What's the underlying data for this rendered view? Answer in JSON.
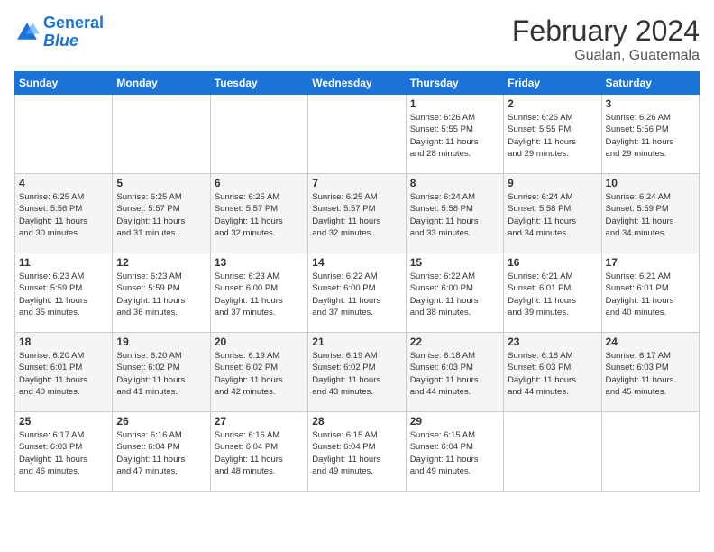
{
  "header": {
    "logo_line1": "General",
    "logo_line2": "Blue",
    "month_title": "February 2024",
    "location": "Gualan, Guatemala"
  },
  "days_of_week": [
    "Sunday",
    "Monday",
    "Tuesday",
    "Wednesday",
    "Thursday",
    "Friday",
    "Saturday"
  ],
  "weeks": [
    [
      {
        "day": "",
        "info": ""
      },
      {
        "day": "",
        "info": ""
      },
      {
        "day": "",
        "info": ""
      },
      {
        "day": "",
        "info": ""
      },
      {
        "day": "1",
        "info": "Sunrise: 6:26 AM\nSunset: 5:55 PM\nDaylight: 11 hours\nand 28 minutes."
      },
      {
        "day": "2",
        "info": "Sunrise: 6:26 AM\nSunset: 5:55 PM\nDaylight: 11 hours\nand 29 minutes."
      },
      {
        "day": "3",
        "info": "Sunrise: 6:26 AM\nSunset: 5:56 PM\nDaylight: 11 hours\nand 29 minutes."
      }
    ],
    [
      {
        "day": "4",
        "info": "Sunrise: 6:25 AM\nSunset: 5:56 PM\nDaylight: 11 hours\nand 30 minutes."
      },
      {
        "day": "5",
        "info": "Sunrise: 6:25 AM\nSunset: 5:57 PM\nDaylight: 11 hours\nand 31 minutes."
      },
      {
        "day": "6",
        "info": "Sunrise: 6:25 AM\nSunset: 5:57 PM\nDaylight: 11 hours\nand 32 minutes."
      },
      {
        "day": "7",
        "info": "Sunrise: 6:25 AM\nSunset: 5:57 PM\nDaylight: 11 hours\nand 32 minutes."
      },
      {
        "day": "8",
        "info": "Sunrise: 6:24 AM\nSunset: 5:58 PM\nDaylight: 11 hours\nand 33 minutes."
      },
      {
        "day": "9",
        "info": "Sunrise: 6:24 AM\nSunset: 5:58 PM\nDaylight: 11 hours\nand 34 minutes."
      },
      {
        "day": "10",
        "info": "Sunrise: 6:24 AM\nSunset: 5:59 PM\nDaylight: 11 hours\nand 34 minutes."
      }
    ],
    [
      {
        "day": "11",
        "info": "Sunrise: 6:23 AM\nSunset: 5:59 PM\nDaylight: 11 hours\nand 35 minutes."
      },
      {
        "day": "12",
        "info": "Sunrise: 6:23 AM\nSunset: 5:59 PM\nDaylight: 11 hours\nand 36 minutes."
      },
      {
        "day": "13",
        "info": "Sunrise: 6:23 AM\nSunset: 6:00 PM\nDaylight: 11 hours\nand 37 minutes."
      },
      {
        "day": "14",
        "info": "Sunrise: 6:22 AM\nSunset: 6:00 PM\nDaylight: 11 hours\nand 37 minutes."
      },
      {
        "day": "15",
        "info": "Sunrise: 6:22 AM\nSunset: 6:00 PM\nDaylight: 11 hours\nand 38 minutes."
      },
      {
        "day": "16",
        "info": "Sunrise: 6:21 AM\nSunset: 6:01 PM\nDaylight: 11 hours\nand 39 minutes."
      },
      {
        "day": "17",
        "info": "Sunrise: 6:21 AM\nSunset: 6:01 PM\nDaylight: 11 hours\nand 40 minutes."
      }
    ],
    [
      {
        "day": "18",
        "info": "Sunrise: 6:20 AM\nSunset: 6:01 PM\nDaylight: 11 hours\nand 40 minutes."
      },
      {
        "day": "19",
        "info": "Sunrise: 6:20 AM\nSunset: 6:02 PM\nDaylight: 11 hours\nand 41 minutes."
      },
      {
        "day": "20",
        "info": "Sunrise: 6:19 AM\nSunset: 6:02 PM\nDaylight: 11 hours\nand 42 minutes."
      },
      {
        "day": "21",
        "info": "Sunrise: 6:19 AM\nSunset: 6:02 PM\nDaylight: 11 hours\nand 43 minutes."
      },
      {
        "day": "22",
        "info": "Sunrise: 6:18 AM\nSunset: 6:03 PM\nDaylight: 11 hours\nand 44 minutes."
      },
      {
        "day": "23",
        "info": "Sunrise: 6:18 AM\nSunset: 6:03 PM\nDaylight: 11 hours\nand 44 minutes."
      },
      {
        "day": "24",
        "info": "Sunrise: 6:17 AM\nSunset: 6:03 PM\nDaylight: 11 hours\nand 45 minutes."
      }
    ],
    [
      {
        "day": "25",
        "info": "Sunrise: 6:17 AM\nSunset: 6:03 PM\nDaylight: 11 hours\nand 46 minutes."
      },
      {
        "day": "26",
        "info": "Sunrise: 6:16 AM\nSunset: 6:04 PM\nDaylight: 11 hours\nand 47 minutes."
      },
      {
        "day": "27",
        "info": "Sunrise: 6:16 AM\nSunset: 6:04 PM\nDaylight: 11 hours\nand 48 minutes."
      },
      {
        "day": "28",
        "info": "Sunrise: 6:15 AM\nSunset: 6:04 PM\nDaylight: 11 hours\nand 49 minutes."
      },
      {
        "day": "29",
        "info": "Sunrise: 6:15 AM\nSunset: 6:04 PM\nDaylight: 11 hours\nand 49 minutes."
      },
      {
        "day": "",
        "info": ""
      },
      {
        "day": "",
        "info": ""
      }
    ]
  ]
}
